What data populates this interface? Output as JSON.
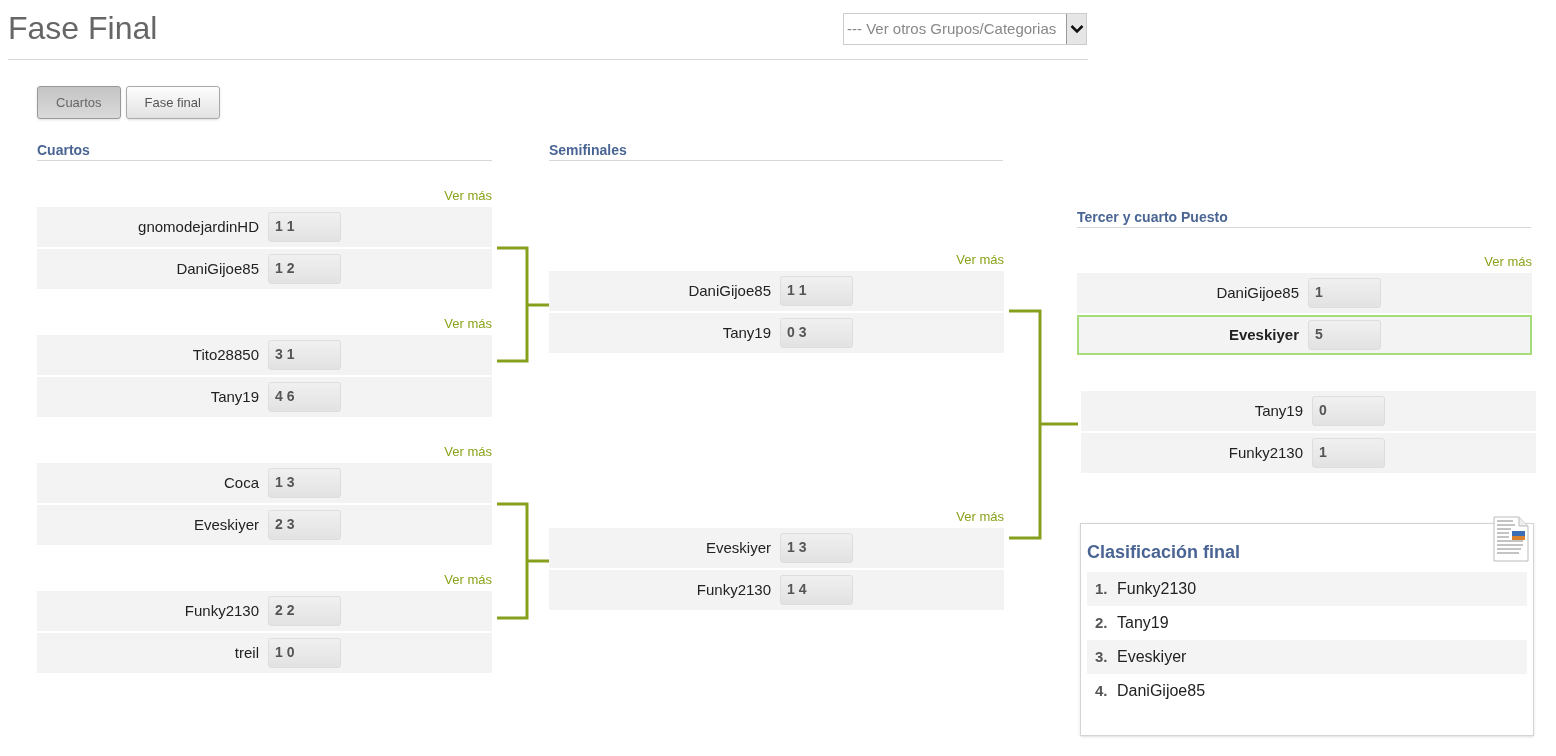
{
  "title": "Fase Final",
  "category_select": {
    "value": "--- Ver otros Grupos/Categorias"
  },
  "tabs": [
    {
      "label": "Cuartos",
      "selected": true
    },
    {
      "label": "Fase final",
      "selected": false
    }
  ],
  "rounds": [
    {
      "heading": "Cuartos",
      "matches": [
        {
          "link": "Ver más",
          "players": [
            {
              "name": "gnomodejardinHD",
              "score": "1 1",
              "highlighted": false
            },
            {
              "name": "DaniGijoe85",
              "score": "1 2",
              "highlighted": false
            }
          ]
        },
        {
          "link": "Ver más",
          "players": [
            {
              "name": "Tito28850",
              "score": "3 1",
              "highlighted": false
            },
            {
              "name": "Tany19",
              "score": "4 6",
              "highlighted": false
            }
          ]
        },
        {
          "link": "Ver más",
          "players": [
            {
              "name": "Coca",
              "score": "1 3",
              "highlighted": false
            },
            {
              "name": "Eveskiyer",
              "score": "2 3",
              "highlighted": false
            }
          ]
        },
        {
          "link": "Ver más",
          "players": [
            {
              "name": "Funky2130",
              "score": "2 2",
              "highlighted": false
            },
            {
              "name": "treil",
              "score": "1 0",
              "highlighted": false
            }
          ]
        }
      ]
    },
    {
      "heading": "Semifinales",
      "matches": [
        {
          "link": "Ver más",
          "players": [
            {
              "name": "DaniGijoe85",
              "score": "1 1",
              "highlighted": false
            },
            {
              "name": "Tany19",
              "score": "0 3",
              "highlighted": false
            }
          ]
        },
        {
          "link": "Ver más",
          "players": [
            {
              "name": "Eveskiyer",
              "score": "1 3",
              "highlighted": false
            },
            {
              "name": "Funky2130",
              "score": "1 4",
              "highlighted": false
            }
          ]
        }
      ]
    },
    {
      "heading": "Tercer y cuarto Puesto",
      "matches": [
        {
          "link": "Ver más",
          "players": [
            {
              "name": "DaniGijoe85",
              "score": "1",
              "highlighted": false
            },
            {
              "name": "Eveskiyer",
              "score": "5",
              "highlighted": true
            }
          ]
        },
        {
          "players": [
            {
              "name": "Tany19",
              "score": "0",
              "highlighted": false
            },
            {
              "name": "Funky2130",
              "score": "1",
              "highlighted": false
            }
          ]
        }
      ]
    }
  ],
  "final_standings": {
    "title": "Clasificación final",
    "items": [
      {
        "rank": "1.",
        "name": "Funky2130"
      },
      {
        "rank": "2.",
        "name": "Tany19"
      },
      {
        "rank": "3.",
        "name": "Eveskiyer"
      },
      {
        "rank": "4.",
        "name": "DaniGijoe85"
      }
    ]
  }
}
